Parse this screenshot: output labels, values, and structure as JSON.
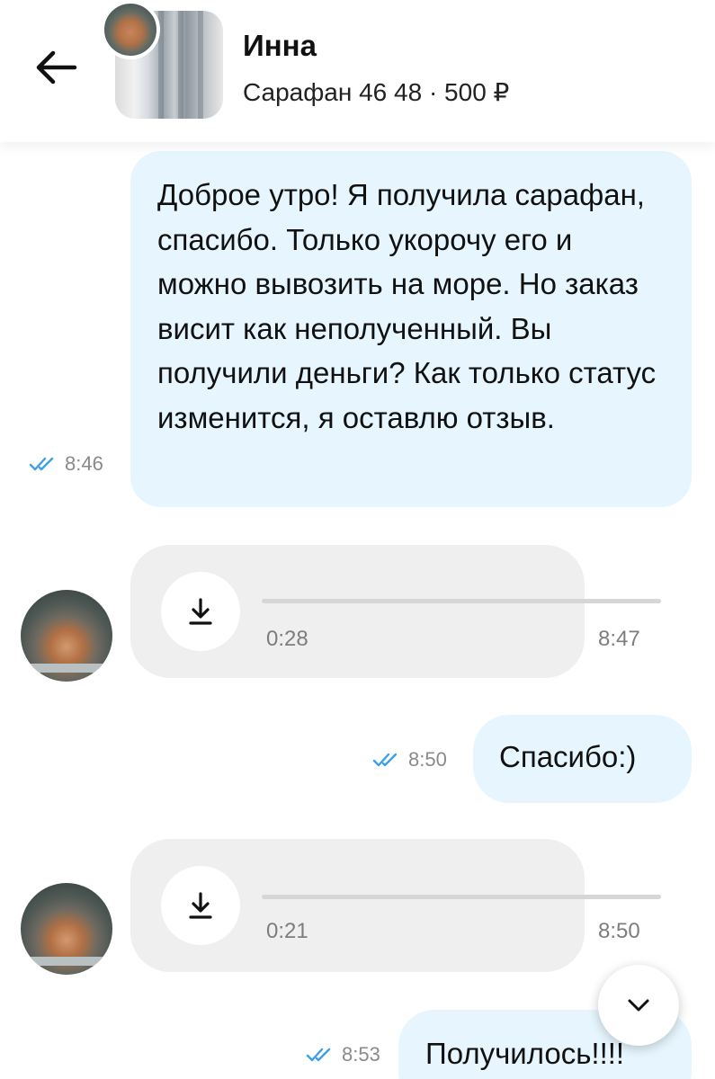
{
  "header": {
    "back_icon": "arrow-left-icon",
    "seller_name": "Инна",
    "item_summary": "Сарафан 46 48 · 500 ₽"
  },
  "messages": [
    {
      "type": "text",
      "direction": "outgoing",
      "text": "Доброе утро! Я получила сарафан, спасибо. Только укорочу его и можно вывозить на море. Но заказ висит как неполученный. Вы получили деньги? Как только статус изменится, я оставлю отзыв.",
      "time": "8:46",
      "status_icon": "double-check-icon"
    },
    {
      "type": "audio",
      "direction": "incoming",
      "duration": "0:28",
      "time": "8:47",
      "icon": "download-icon"
    },
    {
      "type": "text",
      "direction": "outgoing",
      "text": "Спасибо:)",
      "time": "8:50",
      "status_icon": "double-check-icon"
    },
    {
      "type": "audio",
      "direction": "incoming",
      "duration": "0:21",
      "time": "8:50",
      "icon": "download-icon"
    },
    {
      "type": "text",
      "direction": "outgoing",
      "text": "Получилось!!!!",
      "time": "8:53",
      "status_icon": "double-check-icon"
    }
  ],
  "scroll_button": {
    "icon": "chevron-down-icon"
  },
  "colors": {
    "outgoing_bubble": "#e7f6fe",
    "incoming_bubble": "#efefef",
    "read_check": "#3d9fe8",
    "meta_text": "#8a8a8a"
  }
}
